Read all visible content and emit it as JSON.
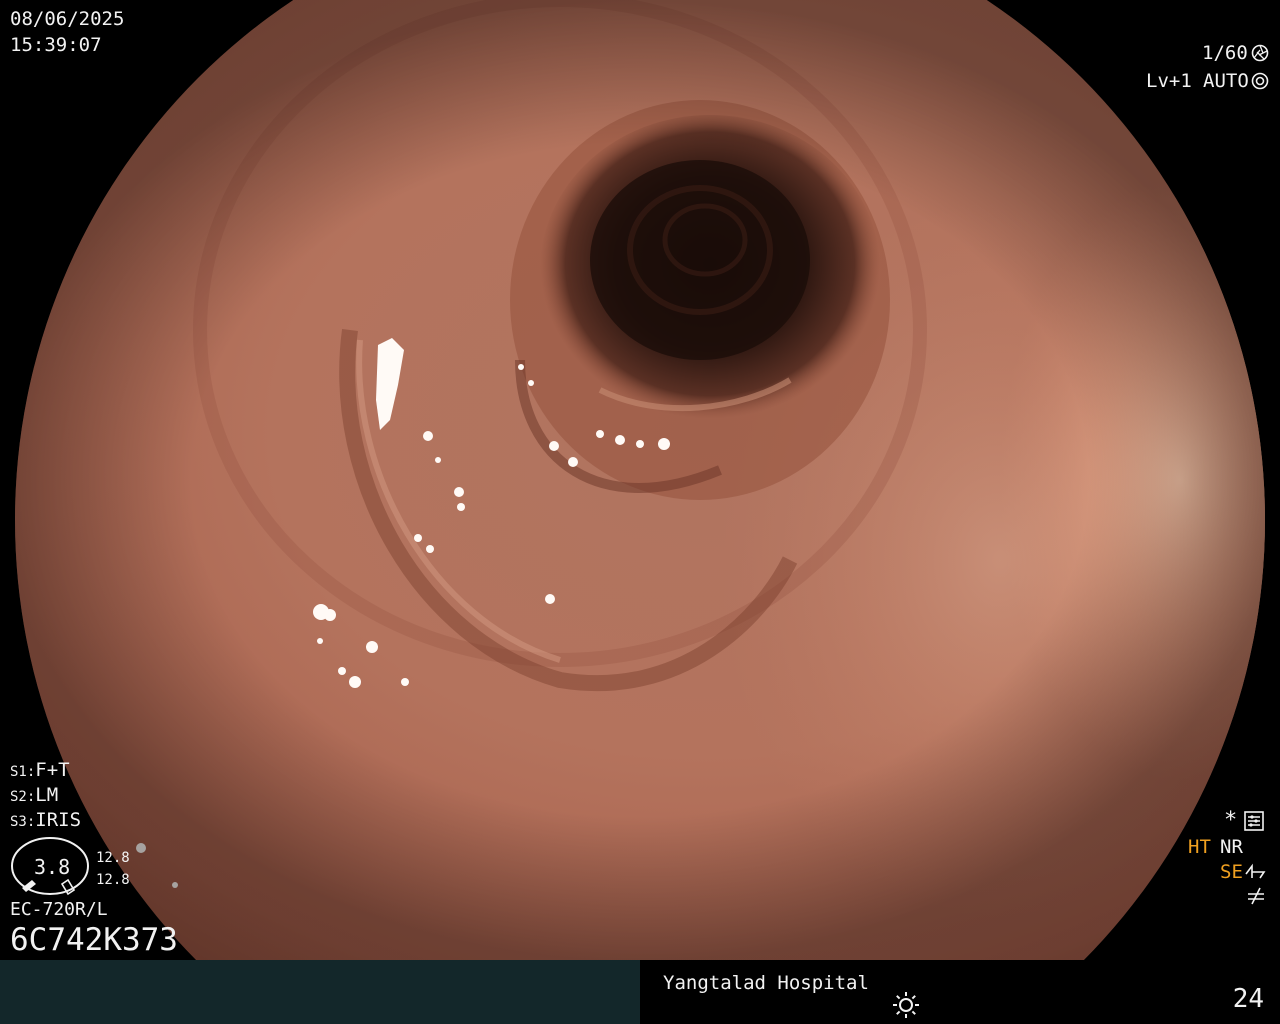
{
  "datetime": {
    "date": "08/06/2025",
    "time": "15:39:07"
  },
  "exposure": {
    "shutter": "1/60",
    "level": "Lv+1",
    "mode": "AUTO",
    "shutter_icon": "aperture-icon",
    "auto_icon": "iris-icon"
  },
  "settings": {
    "s1_key": "S1",
    "s1": "F+T",
    "s2_key": "S2",
    "s2": "LM",
    "s3_key": "S3",
    "s3": "IRIS"
  },
  "gauge": {
    "center": "3.8",
    "upper": "12.8",
    "lower": "12.8",
    "icon": "scope-gauge-icon"
  },
  "scope_model": "EC-720R/L",
  "scope_serial": "6C742K373",
  "modes": {
    "star": "*",
    "ht": "HT",
    "nr": "NR",
    "se": "SE",
    "accent": "#f0a020",
    "icons": [
      "settings-icon",
      "structure-enhance-icon",
      "filter-icon"
    ]
  },
  "footer": {
    "hospital": "Yangtalad Hospital",
    "count": "24",
    "light_icon": "sun-icon",
    "bar_color": "#13272a"
  }
}
